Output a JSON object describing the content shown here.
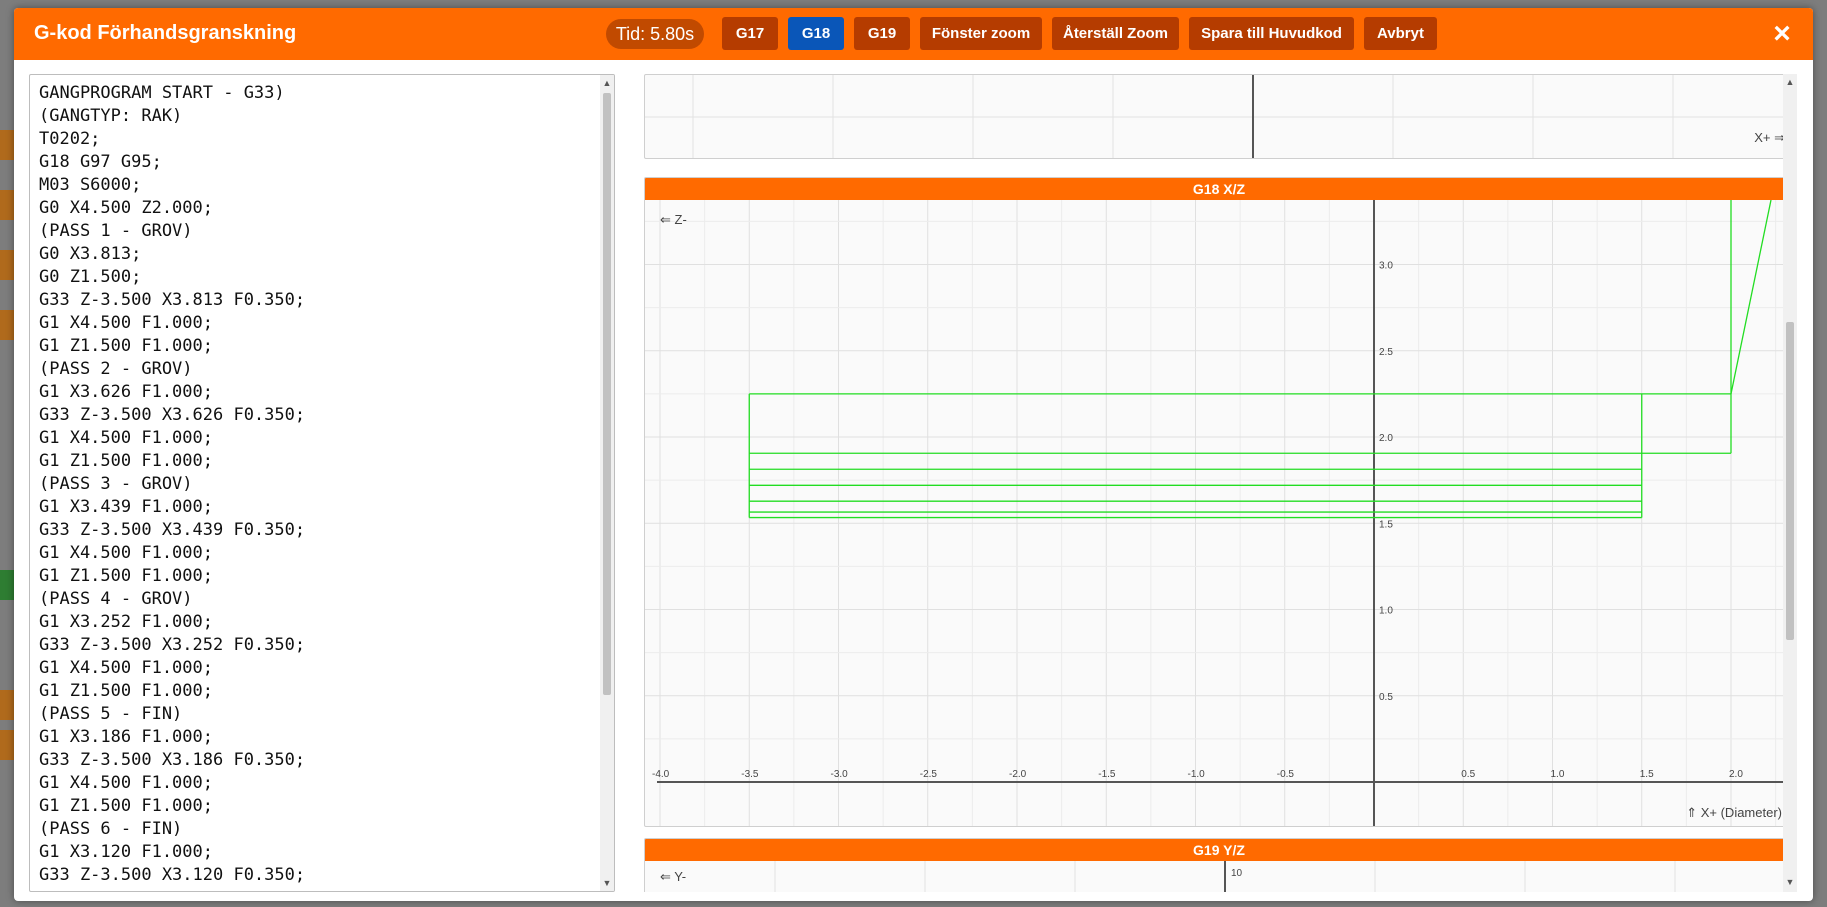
{
  "header": {
    "title": "G-kod Förhandsgranskning",
    "timer": "Tid: 5.80s",
    "buttons": {
      "g17": "G17",
      "g18": "G18",
      "g19": "G19",
      "window_zoom": "Fönster zoom",
      "reset_zoom": "Återställ Zoom",
      "save_main": "Spara till Huvudkod",
      "cancel": "Avbryt"
    },
    "active_plane": "G18",
    "close_glyph": "×"
  },
  "code": {
    "lines": [
      "GANGPROGRAM START - G33)",
      "(GANGTYP: RAK)",
      "T0202;",
      "G18 G97 G95;",
      "M03 S6000;",
      "G0 X4.500 Z2.000;",
      "(PASS 1 - GROV)",
      "G0 X3.813;",
      "G0 Z1.500;",
      "G33 Z-3.500 X3.813 F0.350;",
      "G1 X4.500 F1.000;",
      "G1 Z1.500 F1.000;",
      "(PASS 2 - GROV)",
      "G1 X3.626 F1.000;",
      "G33 Z-3.500 X3.626 F0.350;",
      "G1 X4.500 F1.000;",
      "G1 Z1.500 F1.000;",
      "(PASS 3 - GROV)",
      "G1 X3.439 F1.000;",
      "G33 Z-3.500 X3.439 F0.350;",
      "G1 X4.500 F1.000;",
      "G1 Z1.500 F1.000;",
      "(PASS 4 - GROV)",
      "G1 X3.252 F1.000;",
      "G33 Z-3.500 X3.252 F0.350;",
      "G1 X4.500 F1.000;",
      "G1 Z1.500 F1.000;",
      "(PASS 5 - FIN)",
      "G1 X3.186 F1.000;",
      "G33 Z-3.500 X3.186 F0.350;",
      "G1 X4.500 F1.000;",
      "G1 Z1.500 F1.000;",
      "(PASS 6 - FIN)",
      "G1 X3.120 F1.000;",
      "G33 Z-3.500 X3.120 F0.350;"
    ]
  },
  "top_panel": {
    "x_axis_label": "X+ ⇒"
  },
  "g18_panel": {
    "title": "G18 X/Z",
    "left_label": "⇐ Z-",
    "bottom_label": "⇑ X+ (Diameter)",
    "h_ticks": [
      "-4.0",
      "-3.5",
      "-3.0",
      "-2.5",
      "-2.0",
      "-1.5",
      "-1.0",
      "-0.5",
      "0.5",
      "1.0",
      "1.5",
      "2.0"
    ],
    "h_tick_values": [
      -4.0,
      -3.5,
      -3.0,
      -2.5,
      -2.0,
      -1.5,
      -1.0,
      -0.5,
      0.5,
      1.0,
      1.5,
      2.0
    ],
    "v_ticks": [
      "0.5",
      "1.0",
      "1.5",
      "2.0",
      "2.5",
      "3.0"
    ],
    "v_tick_values": [
      0.5,
      1.0,
      1.5,
      2.0,
      2.5,
      3.0
    ],
    "path_color": "#22dd22",
    "pass_heights": [
      1.533,
      1.565,
      1.628,
      1.72,
      1.813,
      1.906
    ],
    "rapid_level": 2.25,
    "pass_z_start": -3.5,
    "pass_z_end": 1.5,
    "retract_z": 2.0
  },
  "g19_panel": {
    "title": "G19 Y/Z",
    "left_label": "⇐ Y-",
    "tick_top": "10"
  }
}
